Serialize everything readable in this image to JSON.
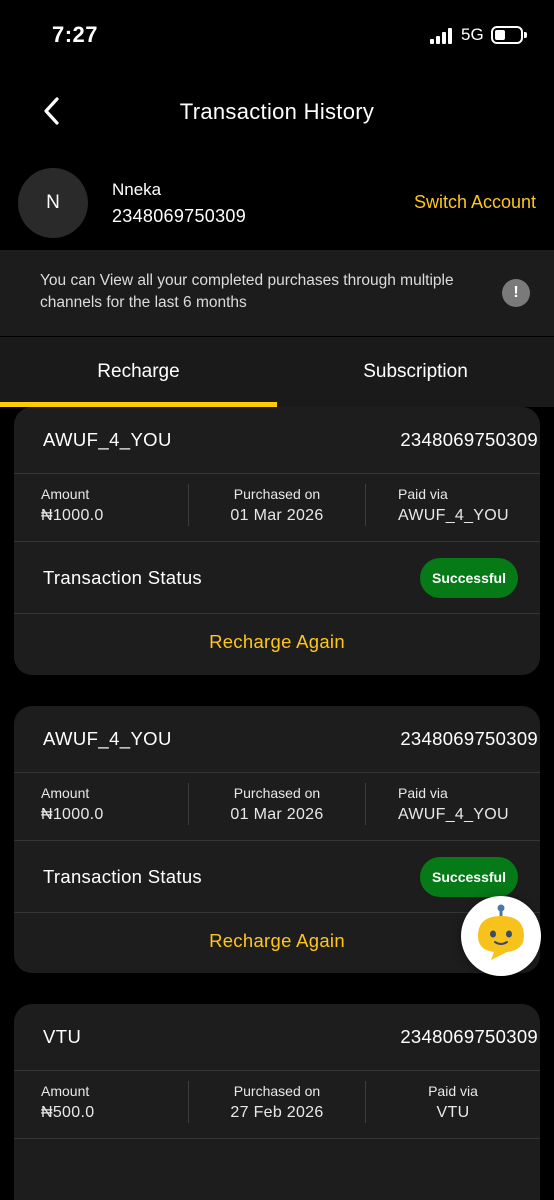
{
  "status_bar": {
    "time": "7:27",
    "network": "5G"
  },
  "header": {
    "title": "Transaction History"
  },
  "account": {
    "avatar_initial": "N",
    "name": "Nneka",
    "number": "2348069750309",
    "switch_label": "Switch Account"
  },
  "info": {
    "text": "You can View all your completed purchases through multiple channels for the last 6 months",
    "icon_glyph": "!"
  },
  "tabs": [
    {
      "label": "Recharge",
      "active": true
    },
    {
      "label": "Subscription",
      "active": false
    }
  ],
  "labels": {
    "amount": "Amount",
    "purchased_on": "Purchased on",
    "paid_via": "Paid via",
    "transaction_status": "Transaction Status",
    "recharge_again": "Recharge Again"
  },
  "transactions": [
    {
      "product": "AWUF_4_YOU",
      "phone": "2348069750309",
      "amount": "₦1000.0",
      "date": "01 Mar 2026",
      "paid_via": "AWUF_4_YOU",
      "status": "Successful"
    },
    {
      "product": "AWUF_4_YOU",
      "phone": "2348069750309",
      "amount": "₦1000.0",
      "date": "01 Mar 2026",
      "paid_via": "AWUF_4_YOU",
      "status": "Successful"
    },
    {
      "product": "VTU",
      "phone": "2348069750309",
      "amount": "₦500.0",
      "date": "27 Feb 2026",
      "paid_via": "VTU"
    }
  ],
  "colors": {
    "accent_yellow": "#FFC61A",
    "tab_indicator": "#FFCB05",
    "success_green": "#057A17",
    "card_bg": "#1d1d1d",
    "page_bg": "#000000"
  },
  "icons": [
    "back-arrow-icon",
    "signal-icon",
    "battery-icon",
    "info-exclamation-icon",
    "chatbot-icon"
  ]
}
